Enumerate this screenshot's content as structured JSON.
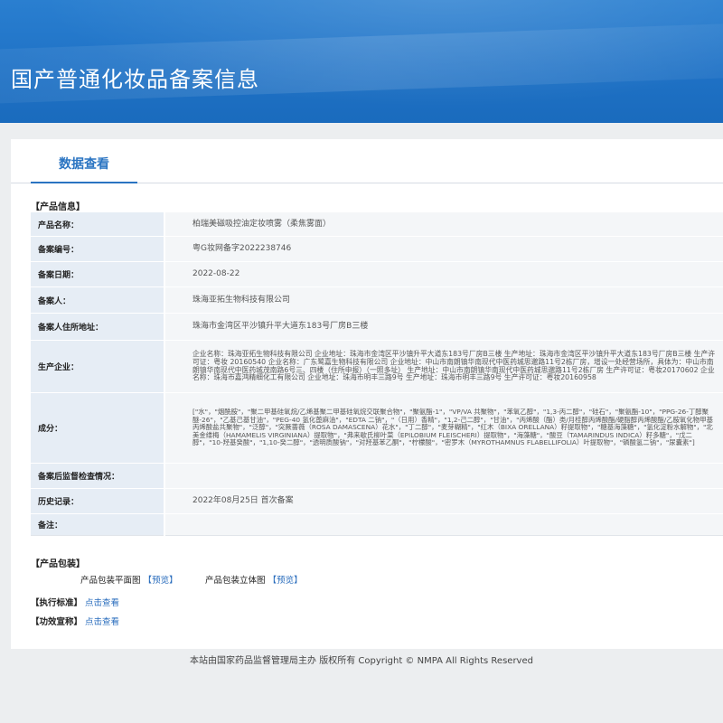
{
  "header": {
    "title": "国产普通化妆品备案信息"
  },
  "tab": {
    "label": "数据查看"
  },
  "product_info": {
    "section": "【产品信息】",
    "rows": [
      {
        "label": "产品名称：",
        "value": "柏瑞美磁吸控油定妆喷雾（柔焦雾面）"
      },
      {
        "label": "备案编号：",
        "value": "粤G妆网备字2022238746"
      },
      {
        "label": "备案日期：",
        "value": "2022-08-22"
      },
      {
        "label": "备案人：",
        "value": "珠海亚拓生物科技有限公司"
      },
      {
        "label": "备案人住所地址：",
        "value": "珠海市金湾区平沙镇升平大道东183号厂房B三楼"
      },
      {
        "label": "生产企业：",
        "value": "企业名称：珠海亚拓生物科技有限公司 企业地址：珠海市金湾区平沙镇升平大道东183号厂房B三楼 生产地址：珠海市金湾区平沙镇升平大道东183号厂房B三楼 生产许可证：粤妆 20160540 企业名称：广东鹭嘉生物科技有限公司 企业地址：中山市南朗镇华南现代中医药城思邈路11号2栋厂房，增设一处经营场所，具体为：中山市南朗镇华南现代中医药城茂南路6号三、四楼（住所申报）（一照多址） 生产地址：中山市南朗镇华南现代中医药城思邈路11号2栋厂房 生产许可证：粤妆20170602 企业名称：珠海市嘉鸿精细化工有限公司 企业地址：珠海市明丰三路9号 生产地址：珠海市明丰三路9号 生产许可证：粤妆20160958"
      },
      {
        "label": "成分：",
        "value": "[\"水\"，\"烟酰胺\"，\"聚二甲基硅氧烷/乙烯基聚二甲基硅氧烷交联聚合物\"，\"聚氨酯-1\"，\"VP/VA 共聚物\"，\"苯氧乙醇\"，\"1,3-丙二醇\"，\"硅石\"，\"聚氨酯-10\"，\"PPG-26-丁醇聚醚-26\"，\"乙基己基甘油\"，\"PEG-40 氢化蓖麻油\"，\"EDTA 二钠\"，\"（日用）香精\"，\"1,2-己二醇\"，\"甘油\"，\"丙烯酸（酯）类/月桂醇丙烯酸酯/硬脂醇丙烯酸酯/乙胺氧化物甲基丙烯酸盐共聚物\"，\"泛醇\"，\"突厥蔷薇（ROSA DAMASCENA）花水\"，\"丁二醇\"，\"麦芽糊精\"，\"红木（BIXA ORELLANA）籽提取物\"，\"糖基海藻糖\"，\"氢化淀粉水解物\"，\"北美金缕梅（HAMAMELIS VIRGINIANA）提取物\"，\"弗来歇氏柳叶菜（EPILOBIUM FLEISCHERI）提取物\"，\"海藻糖\"，\"酸豆（TAMARINDUS INDICA）籽多糖\"，\"戊二醇\"，\"10-羟基癸酸\"，\"1,10-癸二醇\"，\"透明质酸钠\"，\"对羟基苯乙酮\"，\"柠檬酸\"，\"密罗木（MYROTHAMNUS FLABELLIFOLIA）叶提取物\"，\"磷酸氢二钠\"，\"尿囊素\"]"
      },
      {
        "label": "备案后监督检查情况：",
        "value": ""
      },
      {
        "label": "历史记录：",
        "value": "2022年08月25日 首次备案"
      },
      {
        "label": "备注：",
        "value": ""
      }
    ]
  },
  "packaging": {
    "section": "【产品包装】",
    "flat_label": "产品包装平面图",
    "solid_label": "产品包装立体图",
    "preview_link": "预览",
    "bracket_open": "【",
    "bracket_close": "】"
  },
  "standard": {
    "label": "【执行标准】",
    "link": "点击查看"
  },
  "efficacy": {
    "label": "【功效宣称】",
    "link": "点击查看"
  },
  "footer": {
    "text": "本站由国家药品监督管理局主办 版权所有 Copyright © NMPA All Rights Reserved"
  }
}
